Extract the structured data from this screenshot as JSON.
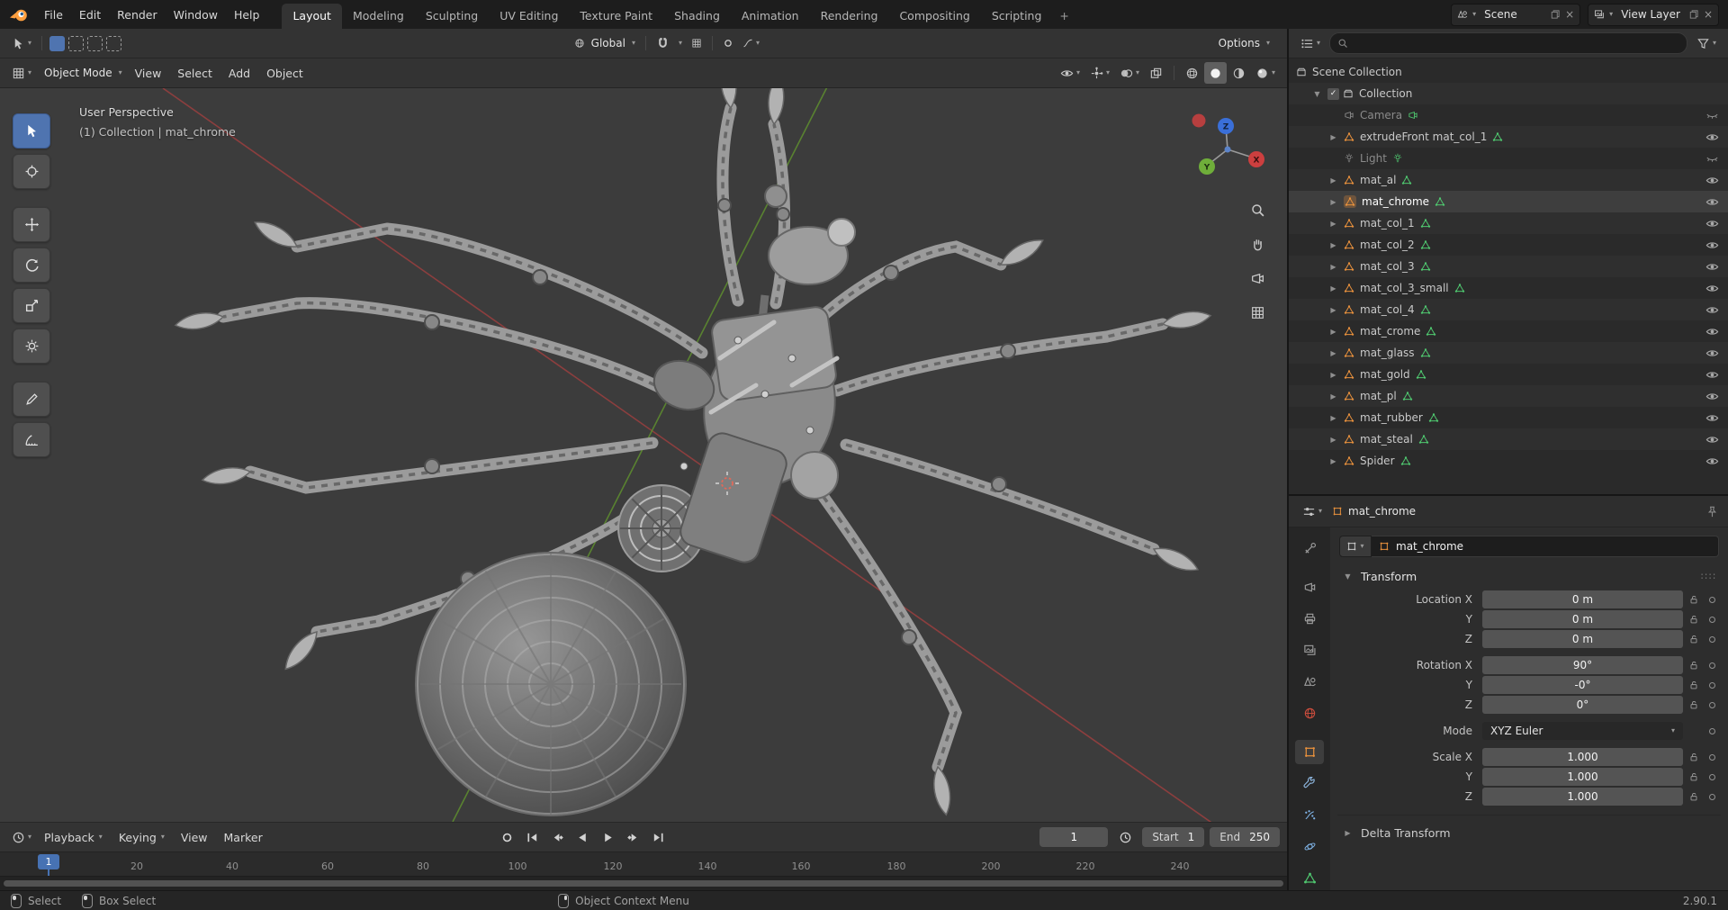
{
  "colors": {
    "accent": "#4772b3",
    "object_orange": "#e8913d",
    "data_green": "#4fc76f",
    "axis_x": "#cc3f3f",
    "axis_y": "#6fae3a",
    "axis_z": "#3a6fd8"
  },
  "icons": {
    "blender-logo": "orange-circle-logo",
    "search": "magnifier",
    "filter": "funnel",
    "snap": "magnet",
    "visibility": "open-eye",
    "hidden": "closed-eye",
    "mesh-object": "orange-triangle",
    "mesh-data": "green-triangle",
    "camera": "camera-body",
    "light": "bulb-with-rays",
    "collection": "box",
    "pin": "pushpin",
    "lock": "open-padlock"
  },
  "topbar": {
    "menus": [
      {
        "label": "File"
      },
      {
        "label": "Edit"
      },
      {
        "label": "Render"
      },
      {
        "label": "Window"
      },
      {
        "label": "Help"
      }
    ],
    "workspaces": [
      {
        "label": "Layout",
        "active": true
      },
      {
        "label": "Modeling"
      },
      {
        "label": "Sculpting"
      },
      {
        "label": "UV Editing"
      },
      {
        "label": "Texture Paint"
      },
      {
        "label": "Shading"
      },
      {
        "label": "Animation"
      },
      {
        "label": "Rendering"
      },
      {
        "label": "Compositing"
      },
      {
        "label": "Scripting"
      }
    ],
    "add_workspace": "+",
    "scene": {
      "label": "Scene"
    },
    "view_layer": {
      "label": "View Layer"
    }
  },
  "tool_settings": {
    "orientation": "Global",
    "options": "Options"
  },
  "viewport": {
    "mode": "Object Mode",
    "menus": [
      {
        "label": "View"
      },
      {
        "label": "Select"
      },
      {
        "label": "Add"
      },
      {
        "label": "Object"
      }
    ],
    "overlay_line1": "User Perspective",
    "overlay_line2": "(1) Collection | mat_chrome",
    "axis": {
      "x": "X",
      "y": "Y",
      "z": "Z"
    }
  },
  "outliner": {
    "root": "Scene Collection",
    "items": [
      {
        "label": "Collection",
        "type": "collection"
      },
      {
        "label": "Camera",
        "type": "camera",
        "muted": true
      },
      {
        "label": "extrudeFront mat_col_1",
        "type": "mesh"
      },
      {
        "label": "Light",
        "type": "light",
        "muted": true
      },
      {
        "label": "mat_al",
        "type": "mesh"
      },
      {
        "label": "mat_chrome",
        "type": "mesh",
        "selected": true
      },
      {
        "label": "mat_col_1",
        "type": "mesh"
      },
      {
        "label": "mat_col_2",
        "type": "mesh"
      },
      {
        "label": "mat_col_3",
        "type": "mesh"
      },
      {
        "label": "mat_col_3_small",
        "type": "mesh"
      },
      {
        "label": "mat_col_4",
        "type": "mesh"
      },
      {
        "label": "mat_crome",
        "type": "mesh"
      },
      {
        "label": "mat_glass",
        "type": "mesh"
      },
      {
        "label": "mat_gold",
        "type": "mesh"
      },
      {
        "label": "mat_pl",
        "type": "mesh"
      },
      {
        "label": "mat_rubber",
        "type": "mesh"
      },
      {
        "label": "mat_steal",
        "type": "mesh"
      },
      {
        "label": "Spider",
        "type": "mesh"
      }
    ]
  },
  "properties": {
    "breadcrumb": "mat_chrome",
    "name": "mat_chrome",
    "transform": {
      "title": "Transform",
      "rows": [
        {
          "label": "Location X",
          "value": "0 m"
        },
        {
          "label": "Y",
          "value": "0 m"
        },
        {
          "label": "Z",
          "value": "0 m"
        },
        {
          "label": "Rotation X",
          "value": "90°"
        },
        {
          "label": "Y",
          "value": "-0°"
        },
        {
          "label": "Z",
          "value": "0°"
        },
        {
          "label": "Mode",
          "value": "XYZ Euler"
        },
        {
          "label": "Scale X",
          "value": "1.000"
        },
        {
          "label": "Y",
          "value": "1.000"
        },
        {
          "label": "Z",
          "value": "1.000"
        }
      ],
      "delta": "Delta Transform"
    }
  },
  "timeline": {
    "menus": [
      {
        "label": "Playback"
      },
      {
        "label": "Keying"
      },
      {
        "label": "View"
      },
      {
        "label": "Marker"
      }
    ],
    "current_frame": "1",
    "start_label": "Start",
    "start_value": "1",
    "end_label": "End",
    "end_value": "250",
    "playhead": "1",
    "ticks": [
      "20",
      "40",
      "60",
      "80",
      "100",
      "120",
      "140",
      "160",
      "180",
      "200",
      "220",
      "240"
    ]
  },
  "statusbar": {
    "select": "Select",
    "box_select": "Box Select",
    "context_menu": "Object Context Menu",
    "version": "2.90.1"
  }
}
